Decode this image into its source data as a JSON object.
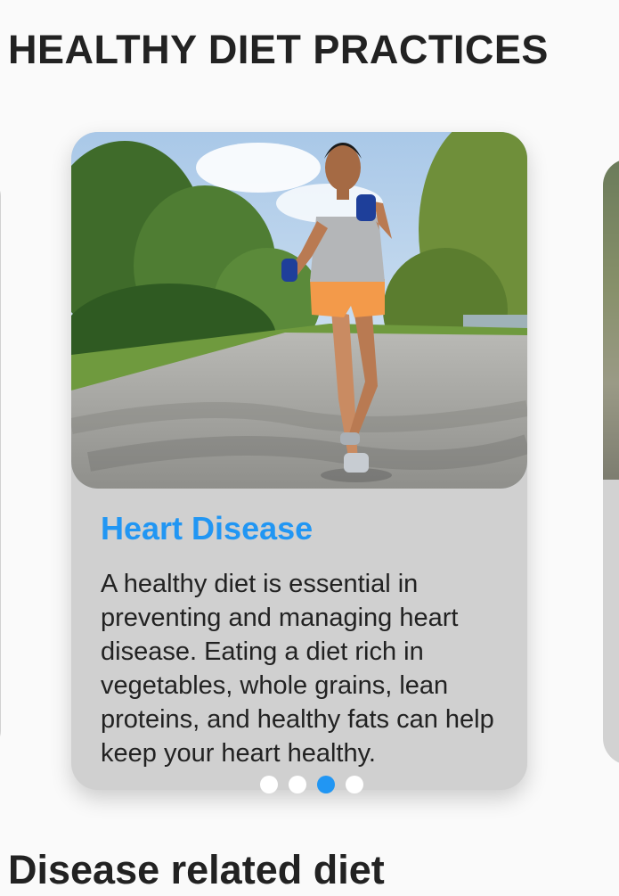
{
  "header": {
    "title": "HEALTHY DIET PRACTICES"
  },
  "carousel": {
    "card": {
      "image": "woman-jogging-with-dumbbells-photo",
      "title": "Heart Disease",
      "body": "A healthy diet is essential in preventing and managing heart disease. Eating a diet rich in vegetables, whole grains, lean proteins, and healthy fats can help keep your heart healthy."
    },
    "page_count": 4,
    "active_index": 2,
    "colors": {
      "accent": "#2196f3",
      "card": "#d0d0d0"
    }
  },
  "section": {
    "title": "Disease related diet"
  }
}
